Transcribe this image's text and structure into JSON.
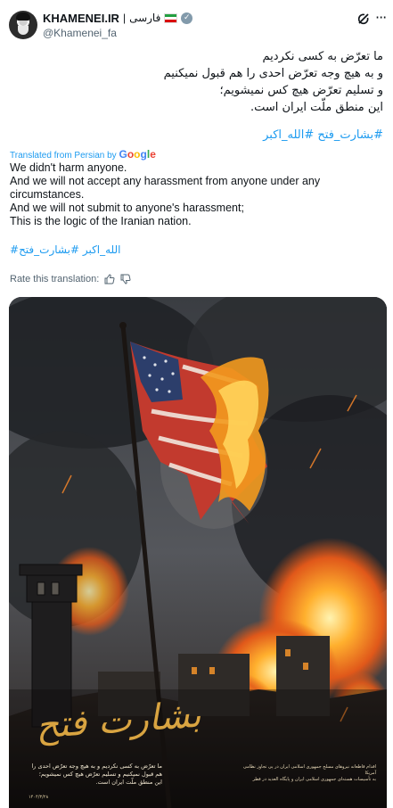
{
  "account": {
    "name": "KHAMENEI.IR",
    "separator": "|",
    "language": "فارسی",
    "handle": "@Khamenei_fa",
    "flag_icon": "iran-flag-icon",
    "verified_icon": "verified-badge-icon"
  },
  "toolbar": {
    "grok_icon": "grok-icon",
    "more_icon": "more-options-icon"
  },
  "tweet": {
    "persian_lines": [
      "ما تعرّض به کسی نکردیم",
      "و به هیچ وجه تعرّض احدی را هم قبول نمیکنیم",
      "و تسلیم تعرّض هیچ کس نمیشویم؛",
      "این منطق ملّت ایران است."
    ],
    "hashtag_persian": "#بشارت_فتح #الله_اکبر",
    "translated_prefix": "Translated from Persian by",
    "google_letters": [
      "G",
      "o",
      "o",
      "g",
      "l",
      "e"
    ],
    "english_lines": [
      "We didn't harm anyone.",
      "And we will not accept any harassment from anyone under any",
      "circumstances.",
      "And we will not submit to anyone's harassment;",
      "This is the logic of the Iranian nation."
    ],
    "hashtag_translated": "#الله_اکبر #بشارت_فتح",
    "rate_label": "Rate this translation:"
  },
  "media": {
    "poster_title": "بشارت فتح",
    "poster_lines": [
      "ما تعرّض به کسی نکردیم و به هیچ وجه تعرّض احدی را",
      "هم قبول نمیکنیم و تسلیم تعرّض هیچ کس نمیشویم؛",
      "این منطق ملّت ایران است."
    ],
    "poster_date": "۱۴۰۴/۳/۲۸",
    "poster_right_lines": [
      "اقدام قاطعانه نیروهای مسلح جمهوری اسلامی ایران در پی تجاوز نظامی آمریکا",
      "به تأسیسات هسته‌ای جمهوری اسلامی ایران و پایگاه العدید در قطر"
    ],
    "colors": {
      "title_gold": "#d9a441",
      "fire": "#f39a1e",
      "smoke": "#2a2c30"
    }
  },
  "colors": {
    "link": "#1d9bf0",
    "muted": "#536471",
    "text": "#0f1419"
  }
}
